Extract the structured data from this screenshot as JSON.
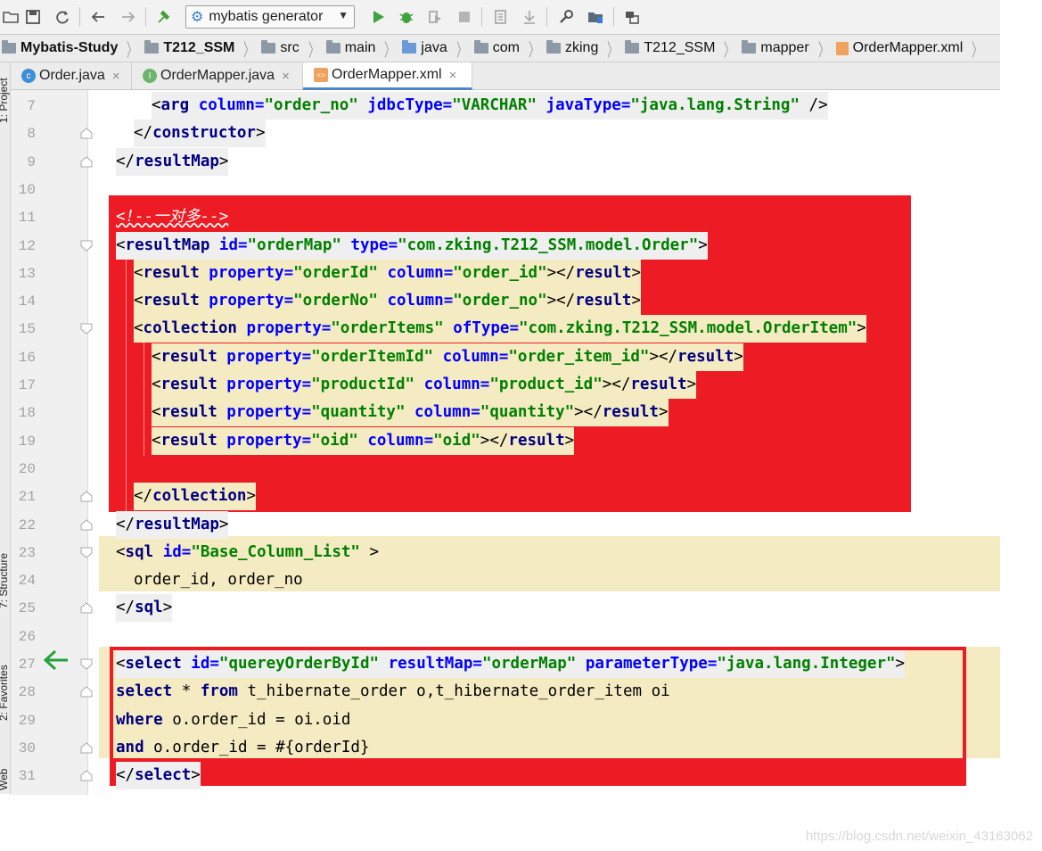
{
  "toolbar": {
    "run_config": "mybatis generator",
    "icons": [
      "open-folder-icon",
      "save-icon",
      "sync-icon",
      "back-icon",
      "forward-icon",
      "build-hammer-icon",
      "run-icon",
      "debug-icon",
      "coverage-icon",
      "stop-icon",
      "project-structure-icon",
      "download-icon",
      "settings-wrench-icon",
      "sdk-icon",
      "terminal-icon"
    ]
  },
  "breadcrumb": [
    "Mybatis-Study",
    "T212_SSM",
    "src",
    "main",
    "java",
    "com",
    "zking",
    "T212_SSM",
    "mapper",
    "OrderMapper.xml"
  ],
  "side_panel": {
    "project": "1: Project",
    "structure": "7: Structure",
    "favorites": "2: Favorites",
    "web": "Web"
  },
  "tabs": [
    {
      "label": "Order.java",
      "badge": "c",
      "color": "#3d8fd6"
    },
    {
      "label": "OrderMapper.java",
      "badge": "I",
      "color": "#6db56d"
    },
    {
      "label": "OrderMapper.xml",
      "badge": "xml",
      "color": "#f0a35e",
      "active": true
    }
  ],
  "line_numbers": [
    "7",
    "8",
    "9",
    "10",
    "11",
    "12",
    "13",
    "14",
    "15",
    "16",
    "17",
    "18",
    "19",
    "20",
    "21",
    "22",
    "23",
    "24",
    "25",
    "26",
    "27",
    "28",
    "29",
    "30",
    "31"
  ],
  "code": {
    "l7": [
      "<",
      "arg",
      " column=",
      "\"order_no\"",
      " jdbcType=",
      "\"VARCHAR\"",
      " javaType=",
      "\"java.lang.String\"",
      " />"
    ],
    "l8": [
      "</",
      "constructor",
      ">"
    ],
    "l9": [
      "</",
      "resultMap",
      ">"
    ],
    "l11": "<!--一对多-->",
    "l12": [
      "<",
      "resultMap",
      " id=",
      "\"orderMap\"",
      " type=",
      "\"com.zking.T212_SSM.model.Order\"",
      ">"
    ],
    "l13": [
      "<",
      "result",
      " property=",
      "\"orderId\"",
      " column=",
      "\"order_id\"",
      "></",
      "result",
      ">"
    ],
    "l14": [
      "<",
      "result",
      " property=",
      "\"orderNo\"",
      " column=",
      "\"order_no\"",
      "></",
      "result",
      ">"
    ],
    "l15": [
      "<",
      "collection",
      " property=",
      "\"orderItems\"",
      " ofType=",
      "\"com.zking.T212_SSM.model.OrderItem\"",
      ">"
    ],
    "l16": [
      "<",
      "result",
      " property=",
      "\"orderItemId\"",
      " column=",
      "\"order_item_id\"",
      "></",
      "result",
      ">"
    ],
    "l17": [
      "<",
      "result",
      " property=",
      "\"productId\"",
      " column=",
      "\"product_id\"",
      "></",
      "result",
      ">"
    ],
    "l18": [
      "<",
      "result",
      " property=",
      "\"quantity\"",
      " column=",
      "\"quantity\"",
      "></",
      "result",
      ">"
    ],
    "l19": [
      "<",
      "result",
      " property=",
      "\"oid\"",
      " column=",
      "\"oid\"",
      "></",
      "result",
      ">"
    ],
    "l21": [
      "</",
      "collection",
      ">"
    ],
    "l22": [
      "</",
      "resultMap",
      ">"
    ],
    "l23": [
      "<",
      "sql",
      " id=",
      "\"Base_Column_List\"",
      " >"
    ],
    "l24": "order_id, order_no",
    "l25": [
      "</",
      "sql",
      ">"
    ],
    "l27": [
      "<",
      "select",
      " id=",
      "\"quereyOrderById\"",
      " resultMap=",
      "\"orderMap\"",
      " parameterType=",
      "\"java.lang.Integer\"",
      ">"
    ],
    "l28": [
      "select",
      " * ",
      "from",
      " t_hibernate_order o,t_hibernate_order_item oi"
    ],
    "l29": [
      "where",
      " o.order_id = oi.oid"
    ],
    "l30": [
      "and",
      " o.order_id = #{orderId}"
    ],
    "l31": [
      "</",
      "select",
      ">"
    ]
  },
  "colors": {
    "annotation_red": "#ed1c24",
    "sql_highlight": "#f5ebc2",
    "tag": "#000080",
    "attr": "#0000ff",
    "value": "#008000",
    "arrow": "#22a33a"
  },
  "watermark": "https://blog.csdn.net/weixin_43163062"
}
